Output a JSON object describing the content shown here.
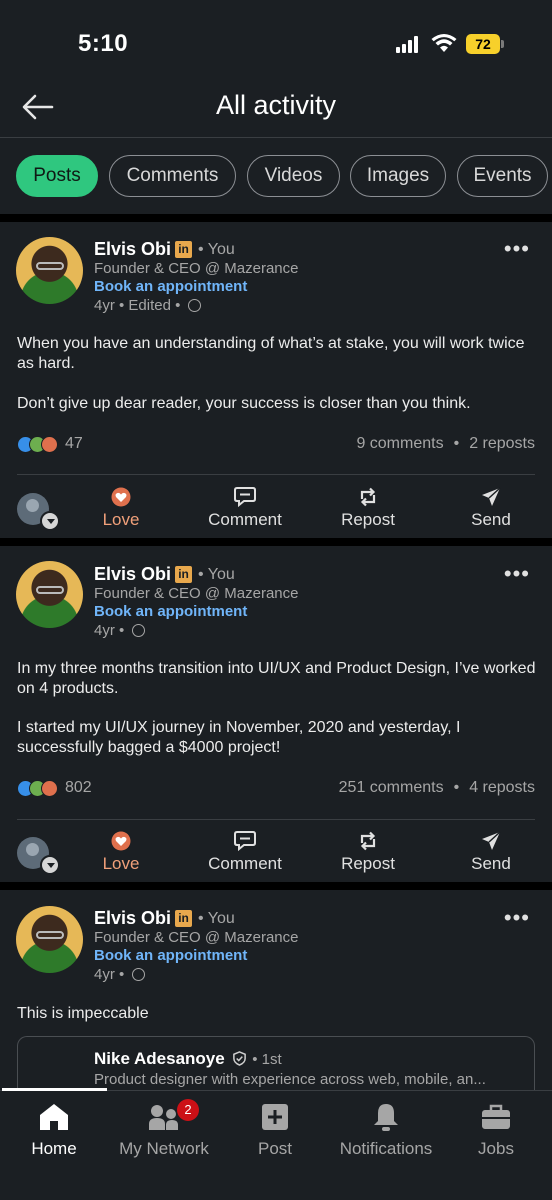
{
  "status": {
    "time": "5:10",
    "battery": "72"
  },
  "header": {
    "title": "All activity"
  },
  "tabs": [
    {
      "label": "Posts"
    },
    {
      "label": "Comments"
    },
    {
      "label": "Videos"
    },
    {
      "label": "Images"
    },
    {
      "label": "Events"
    }
  ],
  "posts": [
    {
      "author": "Elvis Obi",
      "badge": "in",
      "you": "You",
      "headline": "Founder & CEO @ Mazerance",
      "cta": "Book an appointment",
      "meta": "4yr • Edited •",
      "text1": "When you have an understanding of what’s at stake, you will work twice as hard.",
      "text2": "Don’t give up dear reader, your success is closer than you think.",
      "reactions": "47",
      "comments": "9 comments",
      "reposts": "2 reposts"
    },
    {
      "author": "Elvis Obi",
      "badge": "in",
      "you": "You",
      "headline": "Founder & CEO @ Mazerance",
      "cta": "Book an appointment",
      "meta": "4yr •",
      "text1": "In my three months transition into UI/UX and Product Design, I’ve worked on 4 products.",
      "text2": "I started my UI/UX journey in November, 2020 and yesterday, I successfully bagged a $4000 project!",
      "reactions": "802",
      "comments": "251 comments",
      "reposts": "4 reposts"
    },
    {
      "author": "Elvis Obi",
      "badge": "in",
      "you": "You",
      "headline": "Founder & CEO @ Mazerance",
      "cta": "Book an appointment",
      "meta": "4yr •",
      "text1": "This is impeccable",
      "quote": {
        "name": "Nike Adesanoye",
        "degree": "• 1st",
        "headline": "Product designer with experience across web, mobile, an..."
      }
    }
  ],
  "actions": {
    "love": "Love",
    "comment": "Comment",
    "repost": "Repost",
    "send": "Send"
  },
  "nav": {
    "home": "Home",
    "network": "My Network",
    "network_badge": "2",
    "post": "Post",
    "notifications": "Notifications",
    "jobs": "Jobs"
  },
  "colors": {
    "accent": "#2fc77f",
    "link": "#70b5f9",
    "love": "#f0a07a",
    "badge": "#cc1016"
  }
}
